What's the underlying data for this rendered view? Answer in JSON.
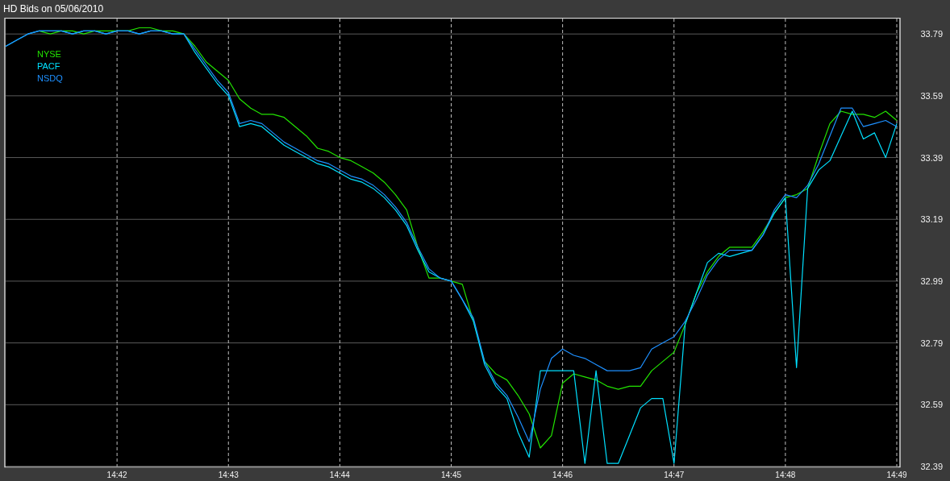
{
  "window": {
    "title": "HD Bids on 05/06/2010"
  },
  "chart": {
    "chart_data": {
      "type": "line",
      "categories": [
        null,
        null,
        null,
        null,
        null,
        null,
        null,
        null,
        null,
        null,
        "14:42",
        null,
        null,
        null,
        null,
        null,
        null,
        null,
        null,
        null,
        "14:43",
        null,
        null,
        null,
        null,
        null,
        null,
        null,
        null,
        null,
        "14:44",
        null,
        null,
        null,
        null,
        null,
        null,
        null,
        null,
        null,
        "14:45",
        null,
        null,
        null,
        null,
        null,
        null,
        null,
        null,
        null,
        "14:46",
        null,
        null,
        null,
        null,
        null,
        null,
        null,
        null,
        null,
        "14:47",
        null,
        null,
        null,
        null,
        null,
        null,
        null,
        null,
        null,
        "14:48",
        null,
        null,
        null,
        null,
        null,
        null,
        null,
        null,
        null,
        "14:49"
      ],
      "series": [
        {
          "name": "NYSE",
          "color": "#22e400",
          "values": [
            null,
            null,
            null,
            33.8,
            33.79,
            33.8,
            33.8,
            33.79,
            33.8,
            33.8,
            33.8,
            33.8,
            33.81,
            33.81,
            33.8,
            33.8,
            33.79,
            33.75,
            33.7,
            33.67,
            33.64,
            33.58,
            33.55,
            33.53,
            33.53,
            33.52,
            33.49,
            33.46,
            33.42,
            33.41,
            33.39,
            33.38,
            33.36,
            33.34,
            33.31,
            33.27,
            33.22,
            33.1,
            33.0,
            33.0,
            32.99,
            32.98,
            32.86,
            32.73,
            32.69,
            32.67,
            32.62,
            32.56,
            32.45,
            32.49,
            32.66,
            32.69,
            32.68,
            32.67,
            32.65,
            32.64,
            32.65,
            32.65,
            32.7,
            32.73,
            32.76,
            32.85,
            32.95,
            33.02,
            33.07,
            33.1,
            33.1,
            33.1,
            33.15,
            33.21,
            33.26,
            33.27,
            33.29,
            33.4,
            33.5,
            33.54,
            33.53,
            33.53,
            33.52,
            33.54,
            33.51
          ]
        },
        {
          "name": "PACF",
          "color": "#00e0ff",
          "values": [
            33.75,
            33.77,
            33.79,
            33.8,
            33.8,
            33.8,
            33.79,
            33.8,
            33.8,
            33.79,
            33.8,
            33.8,
            33.79,
            33.8,
            33.8,
            33.79,
            33.79,
            33.73,
            33.68,
            33.63,
            33.59,
            33.49,
            33.5,
            33.49,
            33.46,
            33.43,
            33.41,
            33.39,
            33.37,
            33.36,
            33.34,
            33.32,
            33.31,
            33.29,
            33.26,
            33.22,
            33.17,
            33.09,
            33.02,
            33.0,
            32.99,
            32.93,
            32.86,
            32.72,
            32.65,
            32.61,
            32.5,
            32.42,
            32.7,
            32.7,
            32.7,
            32.7,
            32.4,
            32.7,
            32.4,
            32.4,
            32.49,
            32.58,
            32.61,
            32.61,
            32.4,
            32.85,
            32.95,
            33.05,
            33.08,
            33.07,
            33.08,
            33.09,
            33.14,
            33.21,
            33.26,
            32.71,
            33.29,
            33.35,
            33.38,
            33.46,
            33.54,
            33.45,
            33.47,
            33.39,
            33.5
          ]
        },
        {
          "name": "NSDQ",
          "color": "#1e90ff",
          "values": [
            33.75,
            33.77,
            33.79,
            33.8,
            33.8,
            33.8,
            33.79,
            33.8,
            33.8,
            33.79,
            33.8,
            33.8,
            33.79,
            33.8,
            33.8,
            33.79,
            33.79,
            33.74,
            33.69,
            33.64,
            33.6,
            33.5,
            33.51,
            33.5,
            33.47,
            33.44,
            33.42,
            33.4,
            33.38,
            33.37,
            33.35,
            33.33,
            33.32,
            33.3,
            33.27,
            33.23,
            33.18,
            33.1,
            33.03,
            33.0,
            32.99,
            32.93,
            32.87,
            32.73,
            32.66,
            32.62,
            32.55,
            32.47,
            32.64,
            32.74,
            32.77,
            32.75,
            32.74,
            32.72,
            32.7,
            32.7,
            32.7,
            32.71,
            32.77,
            32.79,
            32.81,
            32.86,
            32.93,
            33.01,
            33.06,
            33.09,
            33.09,
            33.09,
            33.14,
            33.22,
            33.27,
            33.26,
            33.3,
            33.37,
            33.46,
            33.55,
            33.55,
            33.49,
            33.5,
            33.51,
            33.49
          ]
        }
      ],
      "grid": true,
      "ylim": [
        32.39,
        33.84
      ],
      "yticks": [
        {
          "value": 33.79,
          "label": "33.79"
        },
        {
          "value": 33.59,
          "label": "33.59"
        },
        {
          "value": 33.39,
          "label": "33.39"
        },
        {
          "value": 33.19,
          "label": "33.19"
        },
        {
          "value": 32.99,
          "label": "32.99"
        },
        {
          "value": 32.79,
          "label": "32.79"
        },
        {
          "value": 32.59,
          "label": "32.59"
        },
        {
          "value": 32.39,
          "label": "32.39"
        }
      ]
    }
  }
}
